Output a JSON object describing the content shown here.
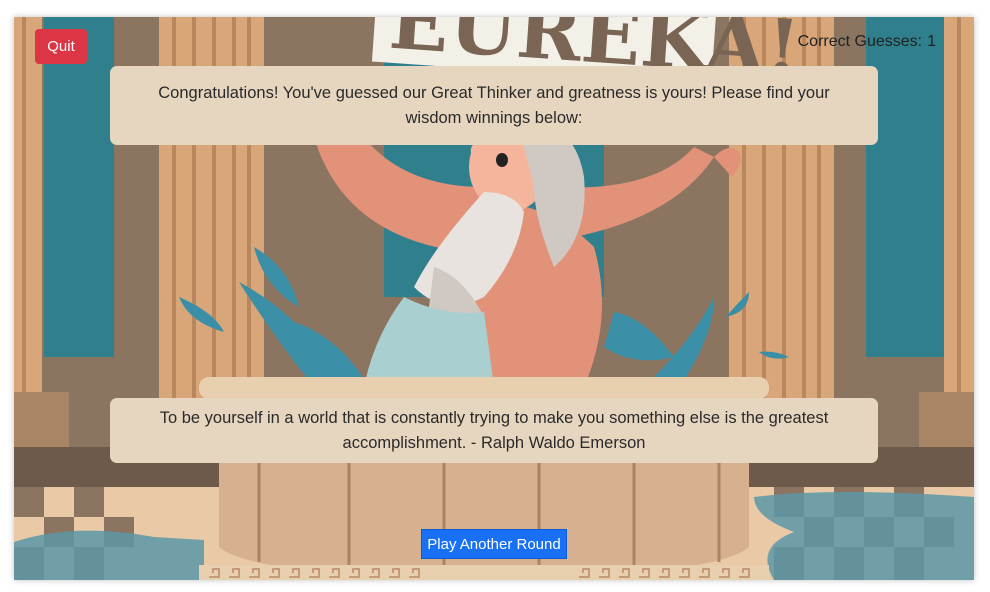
{
  "header": {
    "quit_label": "Quit",
    "score_label": "Correct Guesses:",
    "score_value": "1"
  },
  "result": {
    "message": "Congratulations! You've guessed our Great Thinker and greatness is yours! Please find your wisdom winnings below:"
  },
  "quote": {
    "text": "To be yourself in a world that is constantly trying to make you something else is the greatest accomplishment. - Ralph Waldo Emerson"
  },
  "actions": {
    "play_again_label": "Play Another Round"
  },
  "colors": {
    "quit": "#dc3545",
    "play_again": "#1770f5",
    "panel": "#e6d6c0",
    "background_wall": "#8b7560",
    "column": "#d9a679",
    "teal": "#2f7f8c",
    "water": "#3a8fa6"
  }
}
